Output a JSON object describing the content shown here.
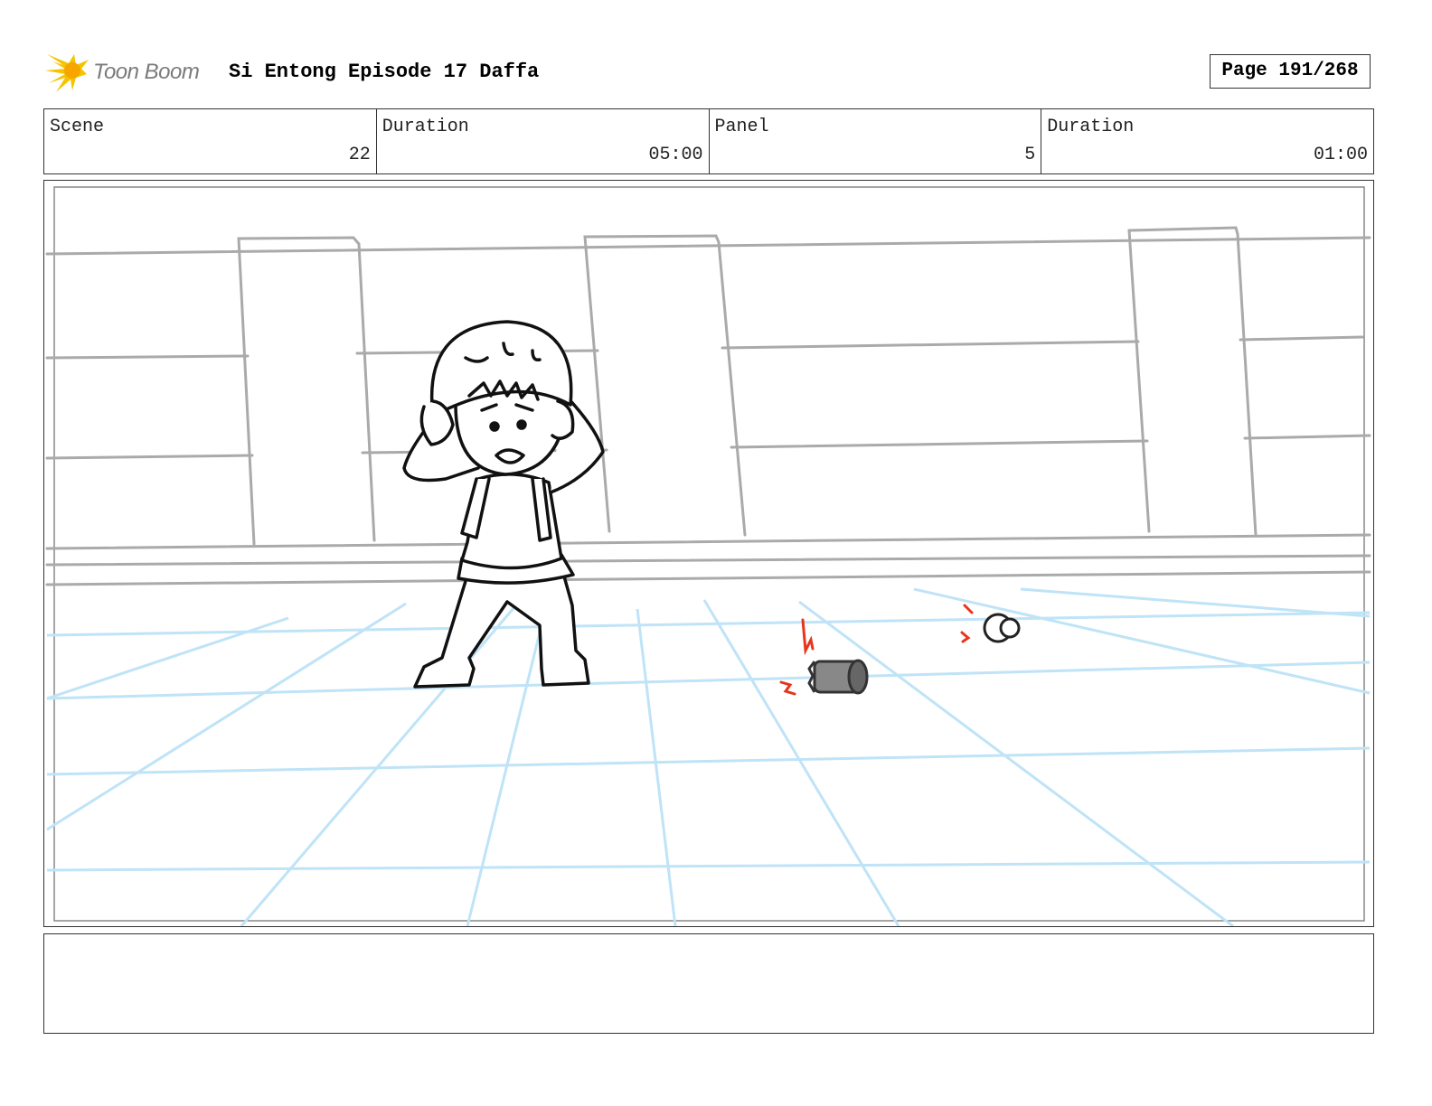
{
  "header": {
    "logo_text": "Toon Boom",
    "title": "Si Entong Episode 17 Daffa",
    "page": "Page 191/268"
  },
  "info": {
    "scene_label": "Scene",
    "scene_value": "22",
    "duration_label": "Duration",
    "duration_value": "05:00",
    "panel_label": "Panel",
    "panel_value": "5",
    "panel_duration_label": "Duration",
    "panel_duration_value": "01:00"
  },
  "notes": {
    "text": ""
  },
  "colors": {
    "wall_lines": "#aaaaaa",
    "floor_grid": "#bfe3f7",
    "character_ink": "#111111",
    "motion_marks": "#e8341c",
    "logo_star": "#f5c400"
  },
  "icons": {
    "logo": "toon-boom-star-icon"
  }
}
